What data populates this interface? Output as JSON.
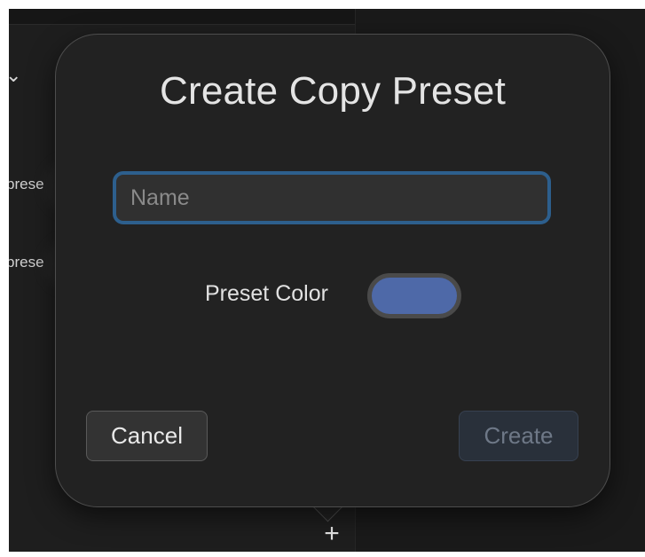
{
  "background": {
    "preset_items": [
      "prese",
      "prese"
    ]
  },
  "dialog": {
    "title": "Create Copy Preset",
    "name_placeholder": "Name",
    "name_value": "",
    "preset_color_label": "Preset Color",
    "preset_color": "#4e69a8",
    "cancel_label": "Cancel",
    "create_label": "Create"
  },
  "toolbar": {
    "add_symbol": "+"
  }
}
